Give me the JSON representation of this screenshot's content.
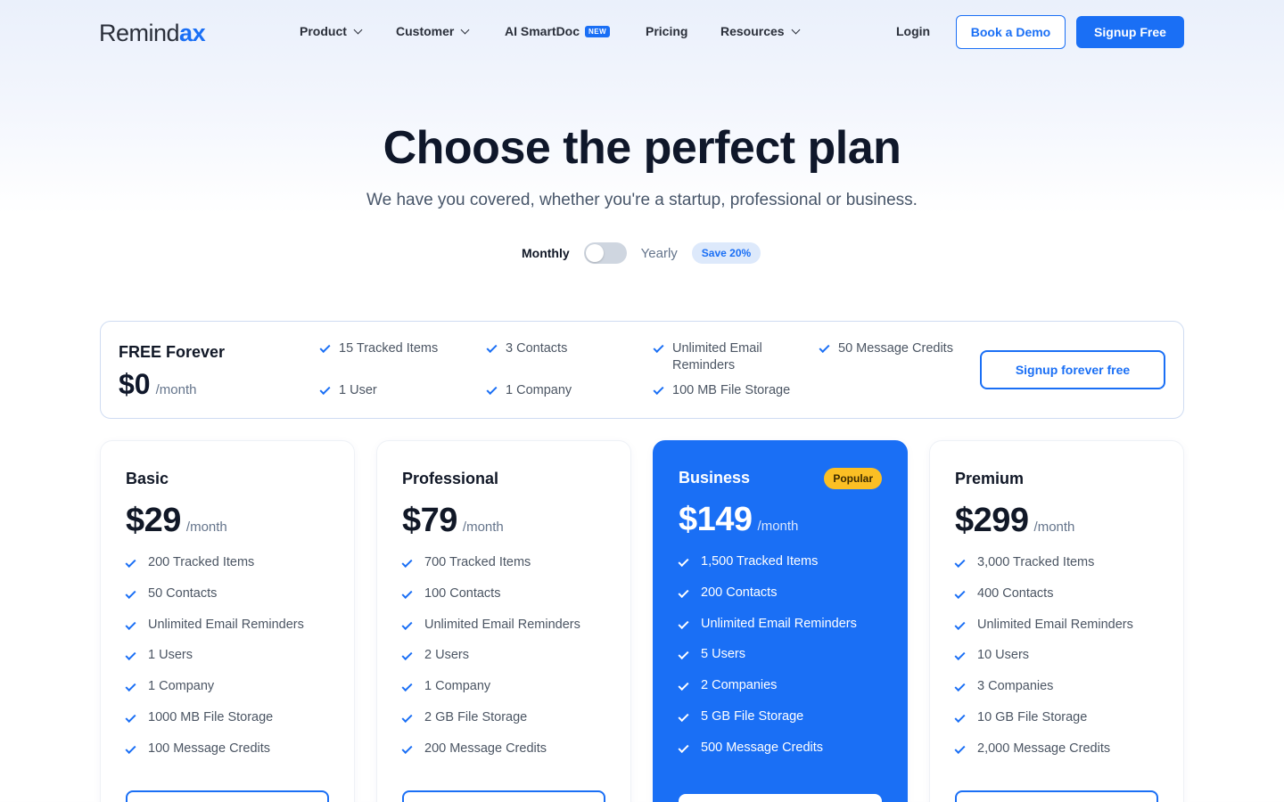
{
  "nav": {
    "logo_main": "Remind",
    "logo_accent": "ax",
    "items": [
      {
        "label": "Product",
        "has_dropdown": true
      },
      {
        "label": "Customer",
        "has_dropdown": true
      },
      {
        "label": "AI SmartDoc",
        "badge": "NEW"
      },
      {
        "label": "Pricing"
      },
      {
        "label": "Resources",
        "has_dropdown": true
      }
    ],
    "login": "Login",
    "demo": "Book a Demo",
    "signup": "Signup Free"
  },
  "hero": {
    "title": "Choose the perfect plan",
    "subtitle": "We have you covered, whether you're a startup, professional or business."
  },
  "billing": {
    "monthly": "Monthly",
    "yearly": "Yearly",
    "save": "Save 20%",
    "selected": "Monthly"
  },
  "free_plan": {
    "name": "FREE Forever",
    "price": "$0",
    "period": "/month",
    "features": [
      "15 Tracked Items",
      "3 Contacts",
      "Unlimited Email Reminders",
      "50 Message Credits",
      "1 User",
      "1 Company",
      "100 MB File Storage"
    ],
    "cta": "Signup forever free"
  },
  "plans": [
    {
      "name": "Basic",
      "price": "$29",
      "period": "/month",
      "features": [
        "200 Tracked Items",
        "50 Contacts",
        "Unlimited Email Reminders",
        "1 Users",
        "1 Company",
        "1000 MB File Storage",
        "100 Message Credits"
      ]
    },
    {
      "name": "Professional",
      "price": "$79",
      "period": "/month",
      "features": [
        "700 Tracked Items",
        "100 Contacts",
        "Unlimited Email Reminders",
        "2 Users",
        "1 Company",
        "2 GB File Storage",
        "200 Message Credits"
      ]
    },
    {
      "name": "Business",
      "price": "$149",
      "period": "/month",
      "badge": "Popular",
      "features": [
        "1,500 Tracked Items",
        "200 Contacts",
        "Unlimited Email Reminders",
        "5 Users",
        "2 Companies",
        "5 GB File Storage",
        "500 Message Credits"
      ]
    },
    {
      "name": "Premium",
      "price": "$299",
      "period": "/month",
      "features": [
        "3,000 Tracked Items",
        "400 Contacts",
        "Unlimited Email Reminders",
        "10 Users",
        "3 Companies",
        "10 GB File Storage",
        "2,000 Message Credits"
      ]
    }
  ],
  "colors": {
    "brand": "#1a6ff5",
    "popular_badge": "#fbbf24",
    "heading": "#0f172a"
  }
}
